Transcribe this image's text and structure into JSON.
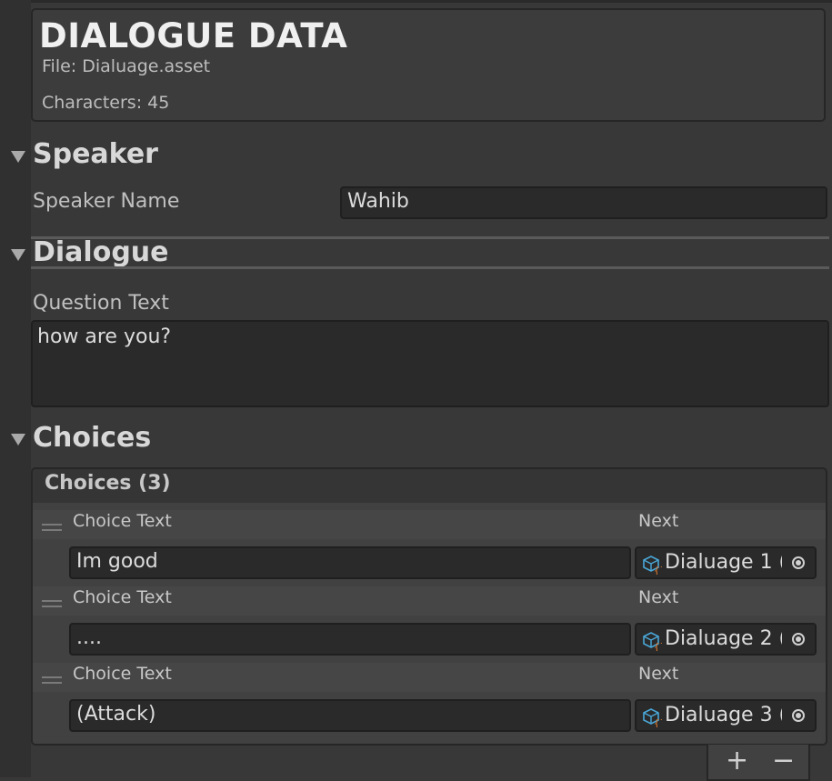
{
  "header": {
    "title": "DIALOGUE DATA",
    "file": "File: Dialuage.asset",
    "characters": "Characters: 45"
  },
  "speaker": {
    "section_title": "Speaker",
    "label": "Speaker Name",
    "value": "Wahib"
  },
  "dialogue": {
    "section_title": "Dialogue",
    "label": "Question Text",
    "value": "how are you?"
  },
  "choices": {
    "section_title": "Choices",
    "list_header": "Choices (3)",
    "items": [
      {
        "choice_label": "Choice Text",
        "next_label": "Next",
        "choice_value": "Im good",
        "next_value": "Dialuage 1 ("
      },
      {
        "choice_label": "Choice Text",
        "next_label": "Next",
        "choice_value": "....",
        "next_value": "Dialuage 2 ("
      },
      {
        "choice_label": "Choice Text",
        "next_label": "Next",
        "choice_value": "(Attack)",
        "next_value": "Dialuage 3 ("
      }
    ],
    "add_label": "+",
    "remove_label": "−"
  },
  "icons": {
    "foldout": "triangle-down-icon",
    "drag": "drag-handle-icon",
    "asset": "scriptable-object-icon",
    "picker": "object-picker-icon"
  },
  "colors": {
    "background": "#383838",
    "field": "#2a2a2a",
    "text": "#c8c8c8",
    "asset_icon_blue": "#4aa8d8",
    "asset_icon_orange": "#e07a30"
  }
}
